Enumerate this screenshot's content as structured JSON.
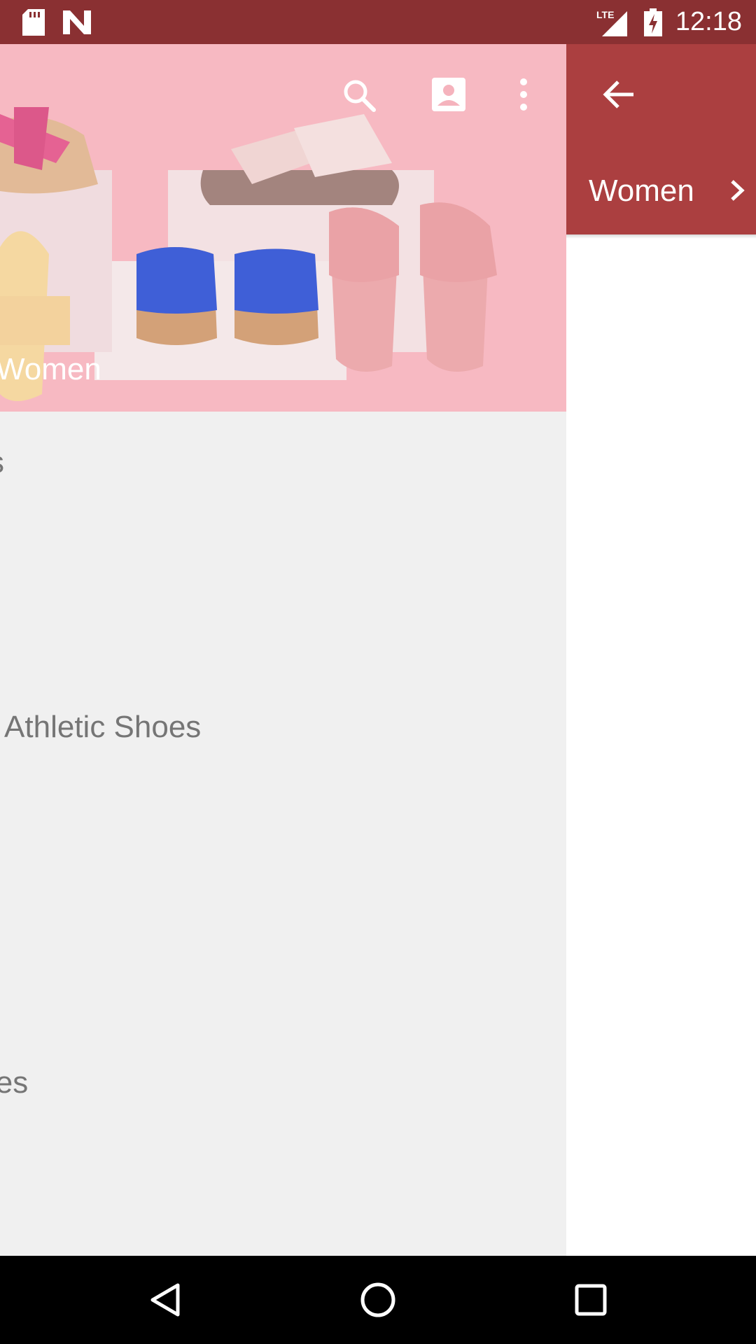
{
  "status_bar": {
    "time": "12:18",
    "network": "LTE",
    "icons": [
      "sd-card-icon",
      "n-icon",
      "lte-signal-icon",
      "battery-charging-icon"
    ]
  },
  "hero": {
    "title": "Women",
    "actions": [
      "search-icon",
      "account-icon",
      "more-vert-icon"
    ]
  },
  "list": {
    "items": [
      "s",
      "Athletic Shoes",
      "les"
    ]
  },
  "drawer": {
    "back_icon": "arrow-back-icon",
    "category": "Women",
    "category_icon": "chevron-right-icon",
    "header_color": "#ab3f40"
  },
  "nav_bar": {
    "buttons": [
      "back-triangle-icon",
      "home-circle-icon",
      "recents-square-icon"
    ]
  },
  "colors": {
    "status_bar": "#8a3032",
    "hero_bg": "#f8b2bc",
    "list_bg": "#f0f0f0",
    "text_muted": "#757575"
  }
}
